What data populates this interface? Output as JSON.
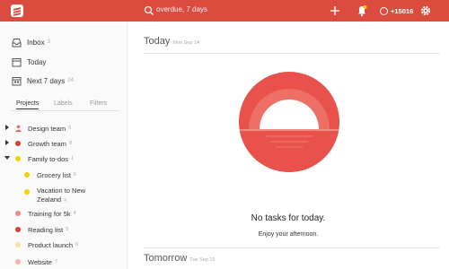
{
  "search": {
    "placeholder": "overdue, 7 days"
  },
  "karma": {
    "value": "+15016"
  },
  "nav": [
    {
      "label": "Inbox",
      "count": "3"
    },
    {
      "label": "Today",
      "count": ""
    },
    {
      "label": "Next 7 days",
      "count": "24"
    }
  ],
  "tabs": [
    {
      "label": "Projects"
    },
    {
      "label": "Labels"
    },
    {
      "label": "Filters"
    }
  ],
  "projects": [
    {
      "label": "Design team",
      "count": "6",
      "color": "#e96d5f"
    },
    {
      "label": "Growth team",
      "count": "8",
      "color": "#db4035"
    },
    {
      "label": "Family to-dos",
      "count": "1",
      "color": "#fad000"
    },
    {
      "label": "Grocery list",
      "count": "6",
      "color": "#fad000"
    },
    {
      "label": "Vacation to New",
      "label2": "Zealand",
      "count": "4",
      "color": "#fad000"
    },
    {
      "label": "Training for 5k",
      "count": "4",
      "color": "#f08a7d"
    },
    {
      "label": "Reading list",
      "count": "5",
      "color": "#db4035"
    },
    {
      "label": "Product launch",
      "count": "6",
      "color": "#fde0a6"
    },
    {
      "label": "Website",
      "count": "7",
      "color": "#f6b3aa"
    }
  ],
  "main": {
    "today_title": "Today",
    "today_date": "Mon Sep 14",
    "empty_title": "No tasks for today.",
    "empty_sub": "Enjoy your afternoon.",
    "tomorrow_title": "Tomorrow",
    "tomorrow_date": "Tue Sep 15"
  },
  "colors": {
    "brand": "#db4c3f",
    "sun_outer": "#e8524a",
    "sun_ring": "#ee6f66",
    "sun_inner": "#ffffff"
  },
  "icons": {
    "logo": "todoist-logo-icon",
    "search": "search-icon",
    "add": "plus-icon",
    "notifications": "bell-icon",
    "karma": "karma-icon",
    "settings": "gear-icon"
  }
}
